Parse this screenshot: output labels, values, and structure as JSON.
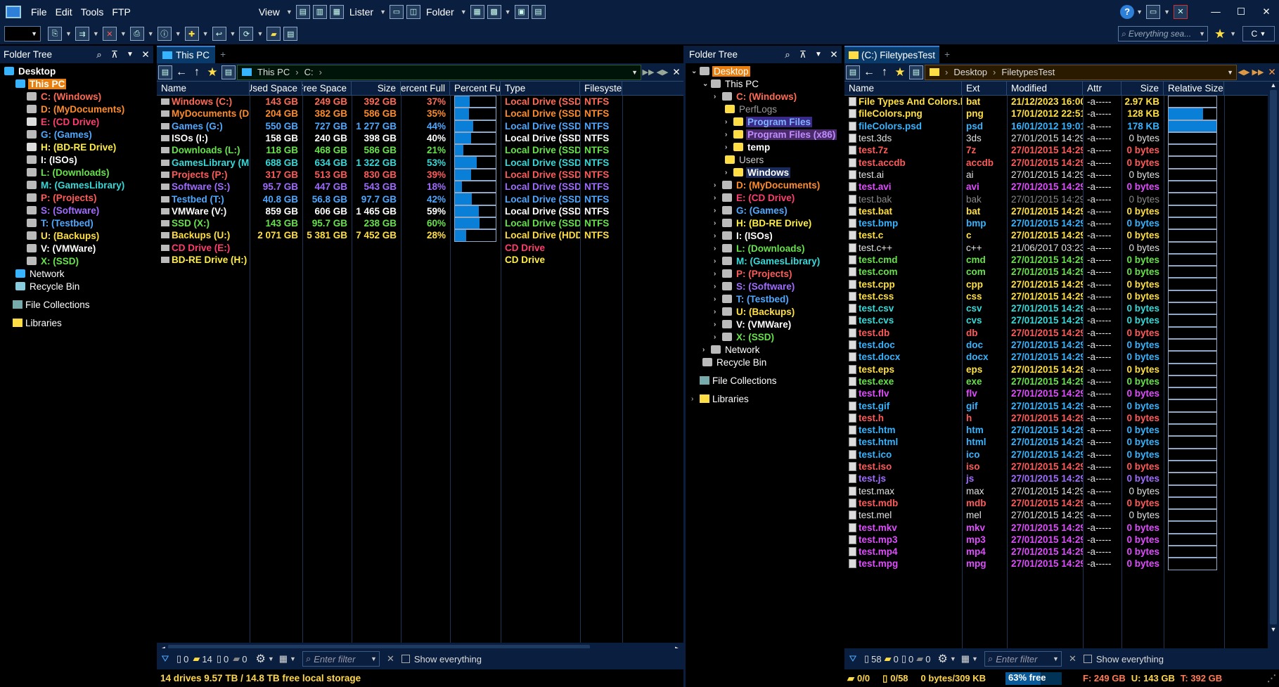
{
  "menu": {
    "file": "File",
    "edit": "Edit",
    "tools": "Tools",
    "ftp": "FTP",
    "view": "View",
    "lister": "Lister",
    "folder": "Folder"
  },
  "search": {
    "placeholder": "Everything sea..."
  },
  "search_drive": "C",
  "left_tree": {
    "title": "Folder Tree",
    "items": [
      {
        "label": "Desktop",
        "color": "#ffffff",
        "indent": 0,
        "icon": "desktop-icon"
      },
      {
        "label": "This PC",
        "color": "#ffffff",
        "indent": 1,
        "icon": "pc-icon",
        "selected": true
      },
      {
        "label": "C: (Windows)",
        "color": "#ff6a55",
        "indent": 2,
        "icon": "drive-icon"
      },
      {
        "label": "D: (MyDocuments)",
        "color": "#ff8c2a",
        "indent": 2,
        "icon": "drive-icon"
      },
      {
        "label": "E: (CD Drive)",
        "color": "#ff3d6e",
        "indent": 2,
        "icon": "cd-icon"
      },
      {
        "label": "G: (Games)",
        "color": "#4fa8ff",
        "indent": 2,
        "icon": "drive-icon"
      },
      {
        "label": "H: (BD-RE Drive)",
        "color": "#ffee44",
        "indent": 2,
        "icon": "cd-icon"
      },
      {
        "label": "I: (ISOs)",
        "color": "#ffffff",
        "indent": 2,
        "icon": "drive-icon"
      },
      {
        "label": "L: (Downloads)",
        "color": "#66e34a",
        "indent": 2,
        "icon": "drive-icon"
      },
      {
        "label": "M: (GamesLibrary)",
        "color": "#36d9d9",
        "indent": 2,
        "icon": "drive-icon"
      },
      {
        "label": "P: (Projects)",
        "color": "#ff5a5a",
        "indent": 2,
        "icon": "drive-icon"
      },
      {
        "label": "S: (Software)",
        "color": "#a06cff",
        "indent": 2,
        "icon": "drive-icon"
      },
      {
        "label": "T: (Testbed)",
        "color": "#4fa8ff",
        "indent": 2,
        "icon": "drive-icon"
      },
      {
        "label": "U: (Backups)",
        "color": "#ffe040",
        "indent": 2,
        "icon": "drive-icon"
      },
      {
        "label": "V: (VMWare)",
        "color": "#ffffff",
        "indent": 2,
        "icon": "drive-icon"
      },
      {
        "label": "X: (SSD)",
        "color": "#66e34a",
        "indent": 2,
        "icon": "drive-icon"
      },
      {
        "label": "Network",
        "color": "#ffffff",
        "indent": 1,
        "icon": "network-icon",
        "normal": true
      },
      {
        "label": "Recycle Bin",
        "color": "#ffffff",
        "indent": 1,
        "icon": "recycle-icon",
        "normal": true
      }
    ],
    "collections": "File Collections",
    "libraries": "Libraries"
  },
  "left_tab": "This PC",
  "left_path": [
    "This PC",
    "C:"
  ],
  "left_columns": [
    "Name",
    "Used Space",
    "Free Space",
    "Size",
    "Percent Full",
    "Percent Full",
    "Type",
    "Filesystem"
  ],
  "drives": [
    {
      "name": "Windows (C:)",
      "used": "143 GB",
      "free": "249 GB",
      "size": "392 GB",
      "pct": "37%",
      "fill": 0.37,
      "type": "Local Drive (SSD)",
      "fs": "NTFS",
      "color": "#ff6a55",
      "typecolor": "#ff6a55"
    },
    {
      "name": "MyDocuments (D:)",
      "used": "204 GB",
      "free": "382 GB",
      "size": "586 GB",
      "pct": "35%",
      "fill": 0.35,
      "type": "Local Drive (SSD)",
      "fs": "NTFS",
      "color": "#ff8c2a",
      "typecolor": "#ff8c2a"
    },
    {
      "name": "Games (G:)",
      "used": "550 GB",
      "free": "727 GB",
      "size": "1 277 GB",
      "pct": "44%",
      "fill": 0.44,
      "type": "Local Drive (SSD)",
      "fs": "NTFS",
      "color": "#4fa8ff",
      "typecolor": "#4fa8ff"
    },
    {
      "name": "ISOs (I:)",
      "used": "158 GB",
      "free": "240 GB",
      "size": "398 GB",
      "pct": "40%",
      "fill": 0.4,
      "type": "Local Drive (SSD)",
      "fs": "NTFS",
      "color": "#ffffff",
      "typecolor": "#ffffff"
    },
    {
      "name": "Downloads (L:)",
      "used": "118 GB",
      "free": "468 GB",
      "size": "586 GB",
      "pct": "21%",
      "fill": 0.21,
      "type": "Local Drive (SSD)",
      "fs": "NTFS",
      "color": "#66e34a",
      "typecolor": "#66e34a"
    },
    {
      "name": "GamesLibrary (M:)",
      "used": "688 GB",
      "free": "634 GB",
      "size": "1 322 GB",
      "pct": "53%",
      "fill": 0.53,
      "type": "Local Drive (SSD)",
      "fs": "NTFS",
      "color": "#36d9d9",
      "typecolor": "#36d9d9"
    },
    {
      "name": "Projects (P:)",
      "used": "317 GB",
      "free": "513 GB",
      "size": "830 GB",
      "pct": "39%",
      "fill": 0.39,
      "type": "Local Drive (SSD)",
      "fs": "NTFS",
      "color": "#ff5a5a",
      "typecolor": "#ff5a5a"
    },
    {
      "name": "Software (S:)",
      "used": "95.7 GB",
      "free": "447 GB",
      "size": "543 GB",
      "pct": "18%",
      "fill": 0.18,
      "type": "Local Drive (SSD)",
      "fs": "NTFS",
      "color": "#a06cff",
      "typecolor": "#a06cff"
    },
    {
      "name": "Testbed (T:)",
      "used": "40.8 GB",
      "free": "56.8 GB",
      "size": "97.7 GB",
      "pct": "42%",
      "fill": 0.42,
      "type": "Local Drive (SSD)",
      "fs": "NTFS",
      "color": "#4fa8ff",
      "typecolor": "#4fa8ff"
    },
    {
      "name": "VMWare (V:)",
      "used": "859 GB",
      "free": "606 GB",
      "size": "1 465 GB",
      "pct": "59%",
      "fill": 0.59,
      "type": "Local Drive (SSD)",
      "fs": "NTFS",
      "color": "#ffffff",
      "typecolor": "#ffffff"
    },
    {
      "name": "SSD (X:)",
      "used": "143 GB",
      "free": "95.7 GB",
      "size": "238 GB",
      "pct": "60%",
      "fill": 0.6,
      "type": "Local Drive (SSD)",
      "fs": "NTFS",
      "color": "#66e34a",
      "typecolor": "#66e34a"
    },
    {
      "name": "Backups (U:)",
      "used": "2 071 GB",
      "free": "5 381 GB",
      "size": "7 452 GB",
      "pct": "28%",
      "fill": 0.28,
      "type": "Local Drive (HDD)",
      "fs": "NTFS",
      "color": "#ffe040",
      "typecolor": "#ffe040"
    },
    {
      "name": "CD Drive (E:)",
      "used": "",
      "free": "",
      "size": "",
      "pct": "",
      "fill": null,
      "type": "CD Drive",
      "fs": "",
      "color": "#ff3d6e",
      "typecolor": "#ff3d6e"
    },
    {
      "name": "BD-RE Drive (H:)",
      "used": "",
      "free": "",
      "size": "",
      "pct": "",
      "fill": null,
      "type": "CD Drive",
      "fs": "",
      "color": "#ffee44",
      "typecolor": "#ffee44"
    }
  ],
  "left_filter": {
    "counts": [
      "0",
      "14",
      "0",
      "0"
    ],
    "placeholder": "Enter filter",
    "show_everything": "Show everything"
  },
  "left_status": "14 drives  9.57 TB / 14.8 TB free local storage",
  "right_tree": {
    "title": "Folder Tree",
    "items": [
      {
        "label": "Desktop",
        "color": "#ffffff",
        "indent": 0,
        "selected": true,
        "normal": true
      },
      {
        "label": "This PC",
        "color": "#ffffff",
        "indent": 1,
        "normal": true
      },
      {
        "label": "C: (Windows)",
        "color": "#ff6a55",
        "indent": 2
      },
      {
        "label": "PerfLogs",
        "color": "#9a9a9a",
        "indent": 3,
        "normal": true
      },
      {
        "label": "Program Files",
        "color": "#7fb4ff",
        "indent": 3,
        "hl": "#3a2a8a"
      },
      {
        "label": "Program Files (x86)",
        "color": "#c08cff",
        "indent": 3,
        "hl": "#4a2a6a"
      },
      {
        "label": "temp",
        "color": "#ffffff",
        "indent": 3
      },
      {
        "label": "Users",
        "color": "#cccccc",
        "indent": 3,
        "normal": true
      },
      {
        "label": "Windows",
        "color": "#ffffff",
        "indent": 3,
        "hl": "#1a2a5a"
      },
      {
        "label": "D: (MyDocuments)",
        "color": "#ff8c2a",
        "indent": 2
      },
      {
        "label": "E: (CD Drive)",
        "color": "#ff3d6e",
        "indent": 2
      },
      {
        "label": "G: (Games)",
        "color": "#4fa8ff",
        "indent": 2
      },
      {
        "label": "H: (BD-RE Drive)",
        "color": "#ffee44",
        "indent": 2
      },
      {
        "label": "I: (ISOs)",
        "color": "#ffffff",
        "indent": 2
      },
      {
        "label": "L: (Downloads)",
        "color": "#66e34a",
        "indent": 2
      },
      {
        "label": "M: (GamesLibrary)",
        "color": "#36d9d9",
        "indent": 2
      },
      {
        "label": "P: (Projects)",
        "color": "#ff5a5a",
        "indent": 2
      },
      {
        "label": "S: (Software)",
        "color": "#a06cff",
        "indent": 2
      },
      {
        "label": "T: (Testbed)",
        "color": "#4fa8ff",
        "indent": 2
      },
      {
        "label": "U: (Backups)",
        "color": "#ffe040",
        "indent": 2
      },
      {
        "label": "V: (VMWare)",
        "color": "#ffffff",
        "indent": 2
      },
      {
        "label": "X: (SSD)",
        "color": "#66e34a",
        "indent": 2
      },
      {
        "label": "Network",
        "color": "#ffffff",
        "indent": 1,
        "normal": true
      },
      {
        "label": "Recycle Bin",
        "color": "#ffffff",
        "indent": 1,
        "normal": true
      }
    ],
    "collections": "File Collections",
    "libraries": "Libraries"
  },
  "right_tab": "(C:) FiletypesTest",
  "right_path": [
    "Desktop",
    "FiletypesTest"
  ],
  "right_columns": [
    "Name",
    "Ext",
    "Modified",
    "Attr",
    "Size",
    "Relative Size"
  ],
  "files": [
    {
      "name": "File Types And Colors.bat",
      "ext": "bat",
      "mod": "21/12/2023 16:00",
      "attr": "-a-----",
      "size": "2.97 KB",
      "rel": 0.0,
      "c": "#ffe040"
    },
    {
      "name": "fileColors.png",
      "ext": "png",
      "mod": "17/01/2012 22:51",
      "attr": "-a-----",
      "size": "128 KB",
      "rel": 0.72,
      "c": "#ffe040"
    },
    {
      "name": "fileColors.psd",
      "ext": "psd",
      "mod": "16/01/2012 19:01",
      "attr": "-a-----",
      "size": "178 KB",
      "rel": 1.0,
      "c": "#36b4ff"
    },
    {
      "name": "test.3ds",
      "ext": "3ds",
      "mod": "27/01/2015 14:29",
      "attr": "-a-----",
      "size": "0 bytes",
      "rel": 0,
      "c": "#e0e0e0",
      "n": true
    },
    {
      "name": "test.7z",
      "ext": "7z",
      "mod": "27/01/2015 14:29",
      "attr": "-a-----",
      "size": "0 bytes",
      "rel": 0,
      "c": "#ff5a5a"
    },
    {
      "name": "test.accdb",
      "ext": "accdb",
      "mod": "27/01/2015 14:29",
      "attr": "-a-----",
      "size": "0 bytes",
      "rel": 0,
      "c": "#ff5a5a"
    },
    {
      "name": "test.ai",
      "ext": "ai",
      "mod": "27/01/2015 14:29",
      "attr": "-a-----",
      "size": "0 bytes",
      "rel": 0,
      "c": "#e0e0e0",
      "n": true
    },
    {
      "name": "test.avi",
      "ext": "avi",
      "mod": "27/01/2015 14:29",
      "attr": "-a-----",
      "size": "0 bytes",
      "rel": 0,
      "c": "#e04cff"
    },
    {
      "name": "test.bak",
      "ext": "bak",
      "mod": "27/01/2015 14:29",
      "attr": "-a-----",
      "size": "0 bytes",
      "rel": 0,
      "c": "#8a8a8a",
      "n": true
    },
    {
      "name": "test.bat",
      "ext": "bat",
      "mod": "27/01/2015 14:29",
      "attr": "-a-----",
      "size": "0 bytes",
      "rel": 0,
      "c": "#ffe040"
    },
    {
      "name": "test.bmp",
      "ext": "bmp",
      "mod": "27/01/2015 14:29",
      "attr": "-a-----",
      "size": "0 bytes",
      "rel": 0,
      "c": "#36b4ff"
    },
    {
      "name": "test.c",
      "ext": "c",
      "mod": "27/01/2015 14:29",
      "attr": "-a-----",
      "size": "0 bytes",
      "rel": 0,
      "c": "#ffe040"
    },
    {
      "name": "test.c++",
      "ext": "c++",
      "mod": "21/06/2017 03:23",
      "attr": "-a-----",
      "size": "0 bytes",
      "rel": 0,
      "c": "#e0e0e0",
      "n": true
    },
    {
      "name": "test.cmd",
      "ext": "cmd",
      "mod": "27/01/2015 14:29",
      "attr": "-a-----",
      "size": "0 bytes",
      "rel": 0,
      "c": "#66e34a"
    },
    {
      "name": "test.com",
      "ext": "com",
      "mod": "27/01/2015 14:29",
      "attr": "-a-----",
      "size": "0 bytes",
      "rel": 0,
      "c": "#66e34a"
    },
    {
      "name": "test.cpp",
      "ext": "cpp",
      "mod": "27/01/2015 14:29",
      "attr": "-a-----",
      "size": "0 bytes",
      "rel": 0,
      "c": "#ffe040"
    },
    {
      "name": "test.css",
      "ext": "css",
      "mod": "27/01/2015 14:29",
      "attr": "-a-----",
      "size": "0 bytes",
      "rel": 0,
      "c": "#ffe040"
    },
    {
      "name": "test.csv",
      "ext": "csv",
      "mod": "27/01/2015 14:29",
      "attr": "-a-----",
      "size": "0 bytes",
      "rel": 0,
      "c": "#36d9d9"
    },
    {
      "name": "test.cvs",
      "ext": "cvs",
      "mod": "27/01/2015 14:29",
      "attr": "-a-----",
      "size": "0 bytes",
      "rel": 0,
      "c": "#36d9d9"
    },
    {
      "name": "test.db",
      "ext": "db",
      "mod": "27/01/2015 14:29",
      "attr": "-a-----",
      "size": "0 bytes",
      "rel": 0,
      "c": "#ff5a5a"
    },
    {
      "name": "test.doc",
      "ext": "doc",
      "mod": "27/01/2015 14:29",
      "attr": "-a-----",
      "size": "0 bytes",
      "rel": 0,
      "c": "#36b4ff"
    },
    {
      "name": "test.docx",
      "ext": "docx",
      "mod": "27/01/2015 14:29",
      "attr": "-a-----",
      "size": "0 bytes",
      "rel": 0,
      "c": "#36b4ff"
    },
    {
      "name": "test.eps",
      "ext": "eps",
      "mod": "27/01/2015 14:29",
      "attr": "-a-----",
      "size": "0 bytes",
      "rel": 0,
      "c": "#ffe040"
    },
    {
      "name": "test.exe",
      "ext": "exe",
      "mod": "27/01/2015 14:29",
      "attr": "-a-----",
      "size": "0 bytes",
      "rel": 0,
      "c": "#66e34a"
    },
    {
      "name": "test.flv",
      "ext": "flv",
      "mod": "27/01/2015 14:29",
      "attr": "-a-----",
      "size": "0 bytes",
      "rel": 0,
      "c": "#e04cff"
    },
    {
      "name": "test.gif",
      "ext": "gif",
      "mod": "27/01/2015 14:29",
      "attr": "-a-----",
      "size": "0 bytes",
      "rel": 0,
      "c": "#36b4ff"
    },
    {
      "name": "test.h",
      "ext": "h",
      "mod": "27/01/2015 14:29",
      "attr": "-a-----",
      "size": "0 bytes",
      "rel": 0,
      "c": "#ff5a5a"
    },
    {
      "name": "test.htm",
      "ext": "htm",
      "mod": "27/01/2015 14:29",
      "attr": "-a-----",
      "size": "0 bytes",
      "rel": 0,
      "c": "#36b4ff"
    },
    {
      "name": "test.html",
      "ext": "html",
      "mod": "27/01/2015 14:29",
      "attr": "-a-----",
      "size": "0 bytes",
      "rel": 0,
      "c": "#36b4ff"
    },
    {
      "name": "test.ico",
      "ext": "ico",
      "mod": "27/01/2015 14:29",
      "attr": "-a-----",
      "size": "0 bytes",
      "rel": 0,
      "c": "#36b4ff"
    },
    {
      "name": "test.iso",
      "ext": "iso",
      "mod": "27/01/2015 14:29",
      "attr": "-a-----",
      "size": "0 bytes",
      "rel": 0,
      "c": "#ff5a5a"
    },
    {
      "name": "test.js",
      "ext": "js",
      "mod": "27/01/2015 14:29",
      "attr": "-a-----",
      "size": "0 bytes",
      "rel": 0,
      "c": "#a06cff"
    },
    {
      "name": "test.max",
      "ext": "max",
      "mod": "27/01/2015 14:29",
      "attr": "-a-----",
      "size": "0 bytes",
      "rel": 0,
      "c": "#e0e0e0",
      "n": true
    },
    {
      "name": "test.mdb",
      "ext": "mdb",
      "mod": "27/01/2015 14:29",
      "attr": "-a-----",
      "size": "0 bytes",
      "rel": 0,
      "c": "#ff5a5a"
    },
    {
      "name": "test.mel",
      "ext": "mel",
      "mod": "27/01/2015 14:29",
      "attr": "-a-----",
      "size": "0 bytes",
      "rel": 0,
      "c": "#e0e0e0",
      "n": true
    },
    {
      "name": "test.mkv",
      "ext": "mkv",
      "mod": "27/01/2015 14:29",
      "attr": "-a-----",
      "size": "0 bytes",
      "rel": 0,
      "c": "#e04cff"
    },
    {
      "name": "test.mp3",
      "ext": "mp3",
      "mod": "27/01/2015 14:29",
      "attr": "-a-----",
      "size": "0 bytes",
      "rel": 0,
      "c": "#e04cff"
    },
    {
      "name": "test.mp4",
      "ext": "mp4",
      "mod": "27/01/2015 14:29",
      "attr": "-a-----",
      "size": "0 bytes",
      "rel": 0,
      "c": "#e04cff"
    },
    {
      "name": "test.mpg",
      "ext": "mpg",
      "mod": "27/01/2015 14:29",
      "attr": "-a-----",
      "size": "0 bytes",
      "rel": 0,
      "c": "#e04cff"
    }
  ],
  "right_filter": {
    "counts": [
      "58",
      "0",
      "0",
      "0"
    ],
    "placeholder": "Enter filter",
    "show_everything": "Show everything"
  },
  "right_status": {
    "folders": "0/0",
    "files": "0/58",
    "bytes": "0 bytes/309 KB",
    "free": "63% free",
    "free_fill": 0.63,
    "f": "F: 249 GB",
    "u": "U: 143 GB",
    "t": "T: 392 GB"
  }
}
